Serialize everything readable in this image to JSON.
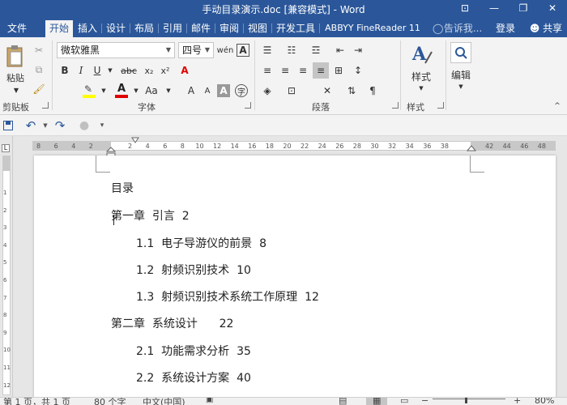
{
  "window": {
    "title": "手动目录演示.doc [兼容模式] - Word",
    "minimize": "—",
    "restore": "❐",
    "close": "✕",
    "options": "⊡"
  },
  "tabs": [
    {
      "label": "文件"
    },
    {
      "label": "开始"
    },
    {
      "label": "插入"
    },
    {
      "label": "设计"
    },
    {
      "label": "布局"
    },
    {
      "label": "引用"
    },
    {
      "label": "邮件"
    },
    {
      "label": "审阅"
    },
    {
      "label": "视图"
    },
    {
      "label": "开发工具"
    },
    {
      "label": "ABBYY FineReader 11"
    }
  ],
  "tell_me": "告诉我...",
  "login": "登录",
  "share": "共享",
  "ribbon": {
    "paste": "粘贴",
    "font_name": "微软雅黑",
    "font_size": "四号",
    "style_label": "样式",
    "edit_label": "编辑",
    "groups": {
      "clipboard": "剪贴板",
      "font": "字体",
      "paragraph": "段落",
      "styles": "样式"
    }
  },
  "ruler": {
    "left_numbers": [
      "8",
      "6",
      "4",
      "2"
    ],
    "numbers": [
      "2",
      "4",
      "6",
      "8",
      "10",
      "12",
      "14",
      "16",
      "18",
      "20",
      "22",
      "24",
      "26",
      "28",
      "30",
      "32",
      "34",
      "36",
      "38"
    ],
    "right_numbers": [
      "42",
      "44",
      "46",
      "48"
    ],
    "vertical_numbers": [
      "1",
      "2",
      "3",
      "4",
      "5",
      "6",
      "7",
      "8",
      "9",
      "10",
      "11",
      "12",
      "13",
      "14"
    ]
  },
  "document": {
    "heading": "目录",
    "entries": [
      {
        "text": "第一章  引言  2"
      },
      {
        "text": "1.1  电子导游仪的前景  8"
      },
      {
        "text": "1.2  射频识别技术  10"
      },
      {
        "text": "1.3  射频识别技术系统工作原理  12"
      },
      {
        "text": "第二章  系统设计      22"
      },
      {
        "text": "2.1  功能需求分析  35"
      },
      {
        "text": "2.2  系统设计方案  40"
      }
    ]
  },
  "status": {
    "page": "第 1 页，共 1 页",
    "words": "80 个字",
    "language": "中文(中国)",
    "zoom": "80%"
  },
  "colors": {
    "accent": "#2b579a",
    "highlight_yellow": "#ffff00",
    "font_red": "#e00000"
  }
}
